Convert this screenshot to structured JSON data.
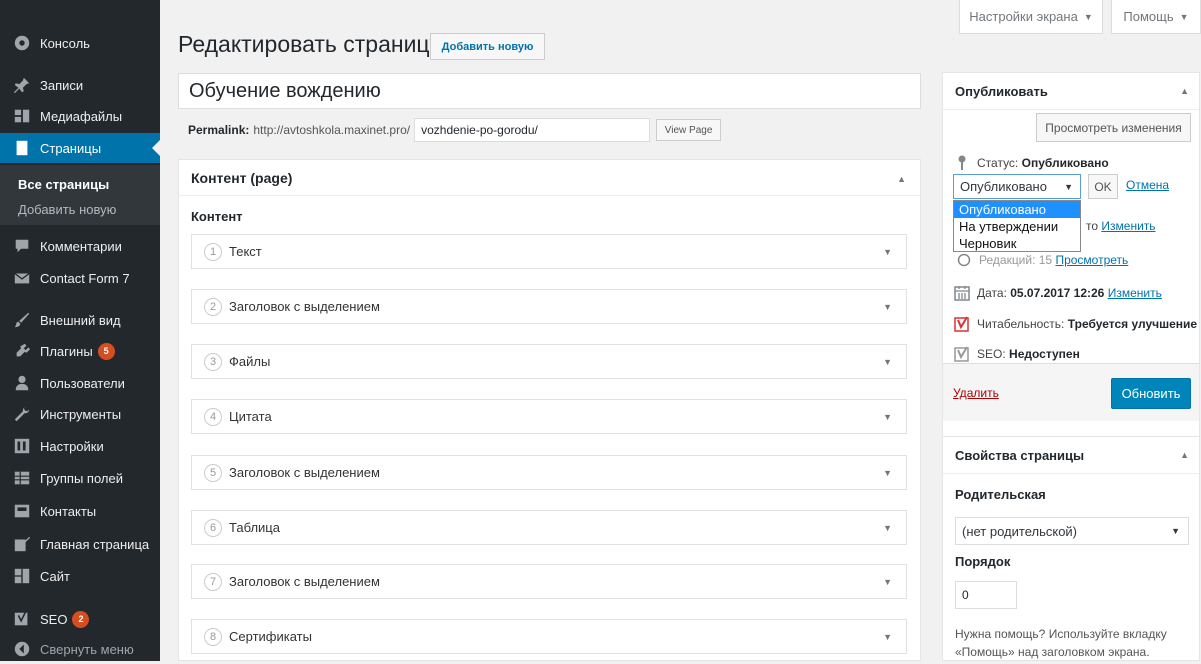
{
  "sidebar": {
    "items": [
      {
        "name": "dashboard",
        "icon": "dashboard-icon",
        "label": "Консоль"
      },
      {
        "name": "posts",
        "icon": "pin-icon",
        "label": "Записи"
      },
      {
        "name": "media",
        "icon": "media-icon",
        "label": "Медиафайлы"
      },
      {
        "name": "pages",
        "icon": "page-icon",
        "label": "Страницы",
        "current": true
      },
      {
        "name": "comments",
        "icon": "comment-icon",
        "label": "Комментарии"
      },
      {
        "name": "contact-form",
        "icon": "mail-icon",
        "label": "Contact Form 7"
      },
      {
        "name": "appearance",
        "icon": "brush-icon",
        "label": "Внешний вид"
      },
      {
        "name": "plugins",
        "icon": "plugin-icon",
        "label": "Плагины",
        "badge": "5"
      },
      {
        "name": "users",
        "icon": "users-icon",
        "label": "Пользователи"
      },
      {
        "name": "tools",
        "icon": "wrench-icon",
        "label": "Инструменты"
      },
      {
        "name": "settings",
        "icon": "settings-icon",
        "label": "Настройки"
      },
      {
        "name": "field-groups",
        "icon": "table-icon",
        "label": "Группы полей"
      },
      {
        "name": "contacts",
        "icon": "contacts-icon",
        "label": "Контакты"
      },
      {
        "name": "home-page",
        "icon": "edit-icon",
        "label": "Главная страница"
      },
      {
        "name": "site",
        "icon": "grid-icon",
        "label": "Сайт"
      },
      {
        "name": "seo",
        "icon": "yoast-icon",
        "label": "SEO",
        "badge": "2"
      },
      {
        "name": "collapse",
        "icon": "collapse-icon",
        "label": "Свернуть меню"
      }
    ],
    "submenu": {
      "all_pages": "Все страницы",
      "add_new": "Добавить новую"
    }
  },
  "header": {
    "screen_options": "Настройки экрана",
    "help": "Помощь",
    "title": "Редактировать страницу",
    "add_new": "Добавить новую"
  },
  "editor": {
    "post_title": "Обучение вождению",
    "permalink_label": "Permalink:",
    "permalink_base": "http://avtoshkola.maxinet.pro/",
    "slug": "vozhdenie-po-gorodu",
    "slug_trailing": "/",
    "view_page": "View Page"
  },
  "content_box": {
    "title": "Контент (page)",
    "field_label": "Контент",
    "layouts": [
      {
        "num": "1",
        "label": "Текст"
      },
      {
        "num": "2",
        "label": "Заголовок с выделением"
      },
      {
        "num": "3",
        "label": "Файлы"
      },
      {
        "num": "4",
        "label": "Цитата"
      },
      {
        "num": "5",
        "label": "Заголовок с выделением"
      },
      {
        "num": "6",
        "label": "Таблица"
      },
      {
        "num": "7",
        "label": "Заголовок с выделением"
      },
      {
        "num": "8",
        "label": "Сертификаты"
      }
    ]
  },
  "publish": {
    "title": "Опубликовать",
    "preview": "Просмотреть изменения",
    "status_label": "Статус:",
    "status_value": "Опубликовано",
    "status_select": "Опубликовано",
    "ok": "OK",
    "cancel": "Отмена",
    "status_options": [
      "Опубликовано",
      "На утверждении",
      "Черновик"
    ],
    "visibility_tail": "то",
    "visibility_edit": "Изменить",
    "revisions_tail": "Редакций: 15",
    "revisions_link": "Просмотреть",
    "date_label": "Дата:",
    "date_value": "05.07.2017 12:26",
    "date_edit": "Изменить",
    "readability_label": "Читабельность:",
    "readability_value": "Требуется улучшение",
    "seo_label": "SEO:",
    "seo_value": "Недоступен",
    "delete": "Удалить",
    "update": "Обновить"
  },
  "page_attributes": {
    "title": "Свойства страницы",
    "parent_label": "Родительская",
    "parent_value": "(нет родительской)",
    "order_label": "Порядок",
    "order_value": "0",
    "help": "Нужна помощь? Используйте вкладку «Помощь» над заголовком экрана."
  },
  "colors": {
    "sidebar_bg": "#23282d",
    "accent": "#0073aa",
    "readability_red": "#dc3232"
  }
}
